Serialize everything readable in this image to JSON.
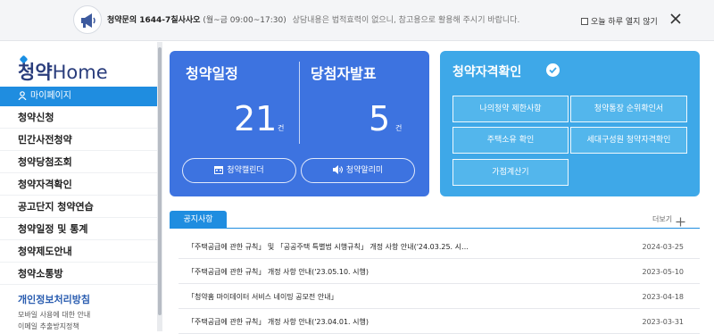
{
  "notice_bar": {
    "lead": "청약문의 1644-7",
    "tail_bold": "칠사사오",
    "hours": "(월~금 09:00~17:30)",
    "disclaimer": "상담내용은 법적효력이 없으니, 참고용으로 활용해 주시기 바랍니다.",
    "no_show_label": "오늘 하루 열지 않기"
  },
  "sidebar": {
    "logo_ko": "청약",
    "logo_en": "Home",
    "mypage_label": "마이페이지",
    "items": [
      {
        "label": "청약신청"
      },
      {
        "label": "민간사전청약"
      },
      {
        "label": "청약당첨조회"
      },
      {
        "label": "청약자격확인"
      },
      {
        "label": "공고단지 청약연습"
      },
      {
        "label": "청약일정 및 통계"
      },
      {
        "label": "청약제도안내"
      },
      {
        "label": "청약소통방"
      }
    ],
    "privacy_label": "개인정보처리방침",
    "sub_links": [
      "모바일 사용에 대한 안내",
      "이메일 추출방지정책"
    ]
  },
  "schedule_card": {
    "schedule_title": "청약일정",
    "schedule_count": "21",
    "winners_title": "당첨자발표",
    "winners_count": "5",
    "unit": "건",
    "calendar_button": "청약캘린더",
    "alert_button": "청약알리미",
    "bg_color": "#3d73e0"
  },
  "qualify_card": {
    "title": "청약자격확인",
    "buttons": [
      "나의청약 제한사항",
      "청약통장 순위확인서",
      "주택소유 확인",
      "세대구성원 청약자격확인",
      "가점계산기"
    ],
    "bg_color": "#3ea8e8"
  },
  "notices": {
    "tab_label": "공지사항",
    "more_label": "더보기",
    "rows": [
      {
        "title": "「주택공급에 관한 규칙」 및 「공공주택 특별법 시행규칙」 개정 사항 안내('24.03.25. 시…",
        "date": "2024-03-25"
      },
      {
        "title": "「주택공급에 관한 규칙」 개정 사항 안내('23.05.10. 시행)",
        "date": "2023-05-10"
      },
      {
        "title": "「청약홈 마이데이터 서비스 네이밍 공모전 안내」",
        "date": "2023-04-18"
      },
      {
        "title": "「주택공급에 관한 규칙」 개정 사항 안내('23.04.01. 시행)",
        "date": "2023-03-31"
      }
    ]
  }
}
